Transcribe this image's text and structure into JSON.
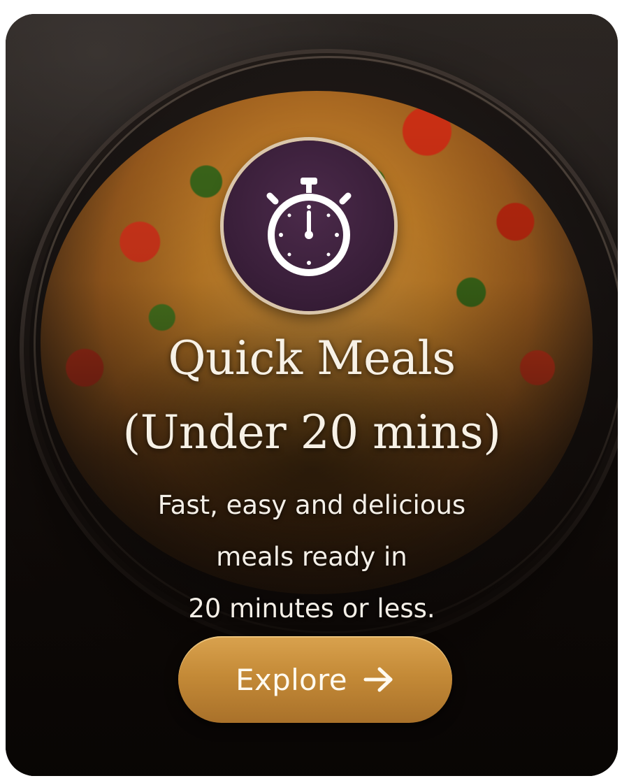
{
  "card": {
    "title_line1": "Quick Meals",
    "title_line2": "(Under 20 mins)",
    "description_lines": [
      "Fast, easy and delicious",
      "meals ready in",
      "20 minutes or less."
    ],
    "badge_icon": "stopwatch-icon",
    "button": {
      "label": "Explore",
      "icon": "arrow-right-icon"
    }
  },
  "colors": {
    "badge_background": "#3a1f3a",
    "badge_ring": "#d9c6ab",
    "button_gold": "#c48a37",
    "text_light": "#f7f1e6"
  }
}
